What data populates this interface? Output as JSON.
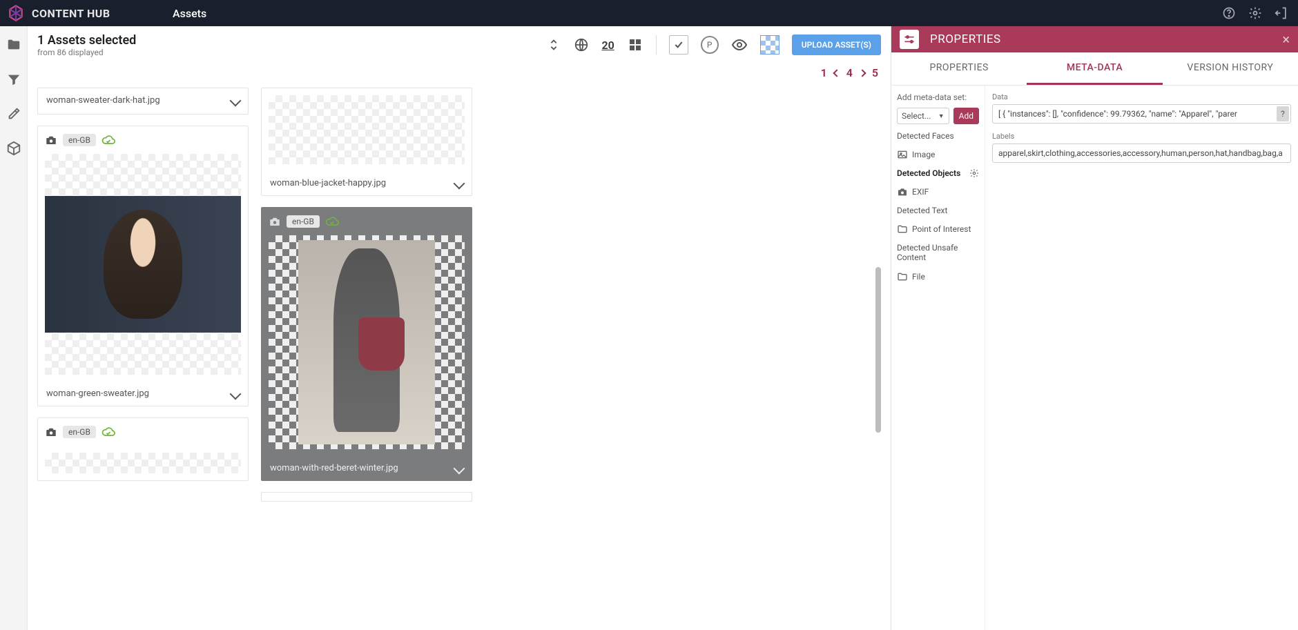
{
  "brand": "CONTENT HUB",
  "page_title": "Assets",
  "selection": {
    "title": "1 Assets selected",
    "sub": "from 86 displayed"
  },
  "toolbar": {
    "sort_count": "20",
    "upload_label": "UPLOAD ASSET(S)",
    "circle_p": "P"
  },
  "pager": {
    "first": "1",
    "current": "4",
    "last": "5"
  },
  "assets": {
    "col1": [
      {
        "name": "woman-sweater-dark-hat.jpg"
      },
      {
        "name": "woman-green-sweater.jpg",
        "locale": "en-GB"
      },
      {
        "name": "",
        "locale": "en-GB"
      }
    ],
    "col2": [
      {
        "name": "woman-blue-jacket-happy.jpg"
      },
      {
        "name": "woman-with-red-beret-winter.jpg",
        "locale": "en-GB",
        "selected": true
      }
    ]
  },
  "props": {
    "title": "PROPERTIES",
    "tabs": {
      "properties": "PROPERTIES",
      "metadata": "META-DATA",
      "history": "VERSION HISTORY"
    },
    "add_label": "Add meta-data set:",
    "select_placeholder": "Select...",
    "add_btn": "Add",
    "meta_sets": {
      "detected_faces": "Detected Faces",
      "image": "Image",
      "detected_objects": "Detected Objects",
      "exif": "EXIF",
      "detected_text": "Detected Text",
      "poi": "Point of Interest",
      "unsafe": "Detected Unsafe Content",
      "file": "File"
    },
    "fields": {
      "data_label": "Data",
      "data_value": "[ {   \"instances\": [],   \"confidence\": 99.79362,   \"name\": \"Apparel\",   \"parer",
      "labels_label": "Labels",
      "labels_value": "apparel,skirt,clothing,accessories,accessory,human,person,hat,handbag,bag,a"
    },
    "help": "?"
  }
}
